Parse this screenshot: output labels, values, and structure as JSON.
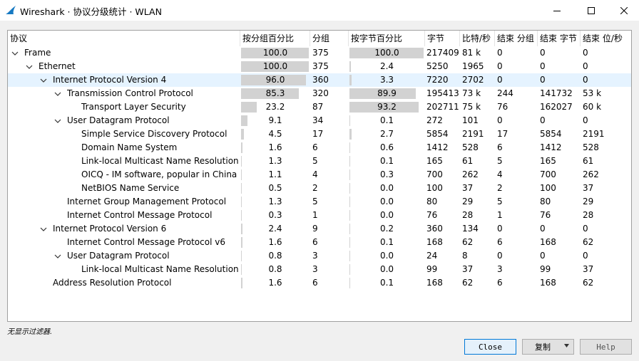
{
  "window": {
    "title": "Wireshark · 协议分级统计 · WLAN"
  },
  "columns": [
    "协议",
    "按分组百分比",
    "分组",
    "按字节百分比",
    "字节",
    "比特/秒",
    "结束 分组",
    "结束 字节",
    "结束 位/秒"
  ],
  "rows": [
    {
      "protocol": "Frame",
      "level": 0,
      "expander": "open",
      "pkt_pct": "100.0",
      "pkts": "375",
      "byte_pct": "100.0",
      "bytes": "217409",
      "bps": "81 k",
      "end_pkts": "0",
      "end_bytes": "0",
      "end_bps": "0"
    },
    {
      "protocol": "Ethernet",
      "level": 1,
      "expander": "open",
      "pkt_pct": "100.0",
      "pkts": "375",
      "byte_pct": "2.4",
      "bytes": "5250",
      "bps": "1965",
      "end_pkts": "0",
      "end_bytes": "0",
      "end_bps": "0"
    },
    {
      "protocol": "Internet Protocol Version 4",
      "level": 2,
      "expander": "open",
      "selected": true,
      "pkt_pct": "96.0",
      "pkts": "360",
      "byte_pct": "3.3",
      "bytes": "7220",
      "bps": "2702",
      "end_pkts": "0",
      "end_bytes": "0",
      "end_bps": "0"
    },
    {
      "protocol": "Transmission Control Protocol",
      "level": 3,
      "expander": "open",
      "pkt_pct": "85.3",
      "pkts": "320",
      "byte_pct": "89.9",
      "bytes": "195413",
      "bps": "73 k",
      "end_pkts": "244",
      "end_bytes": "141732",
      "end_bps": "53 k"
    },
    {
      "protocol": "Transport Layer Security",
      "level": 4,
      "expander": "none",
      "pkt_pct": "23.2",
      "pkts": "87",
      "byte_pct": "93.2",
      "bytes": "202711",
      "bps": "75 k",
      "end_pkts": "76",
      "end_bytes": "162027",
      "end_bps": "60 k"
    },
    {
      "protocol": "User Datagram Protocol",
      "level": 3,
      "expander": "open",
      "pkt_pct": "9.1",
      "pkts": "34",
      "byte_pct": "0.1",
      "bytes": "272",
      "bps": "101",
      "end_pkts": "0",
      "end_bytes": "0",
      "end_bps": "0"
    },
    {
      "protocol": "Simple Service Discovery Protocol",
      "level": 4,
      "expander": "none",
      "pkt_pct": "4.5",
      "pkts": "17",
      "byte_pct": "2.7",
      "bytes": "5854",
      "bps": "2191",
      "end_pkts": "17",
      "end_bytes": "5854",
      "end_bps": "2191"
    },
    {
      "protocol": "Domain Name System",
      "level": 4,
      "expander": "none",
      "pkt_pct": "1.6",
      "pkts": "6",
      "byte_pct": "0.6",
      "bytes": "1412",
      "bps": "528",
      "end_pkts": "6",
      "end_bytes": "1412",
      "end_bps": "528"
    },
    {
      "protocol": "Link-local Multicast Name Resolution",
      "level": 4,
      "expander": "none",
      "pkt_pct": "1.3",
      "pkts": "5",
      "byte_pct": "0.1",
      "bytes": "165",
      "bps": "61",
      "end_pkts": "5",
      "end_bytes": "165",
      "end_bps": "61"
    },
    {
      "protocol": "OICQ - IM software, popular in China",
      "level": 4,
      "expander": "none",
      "pkt_pct": "1.1",
      "pkts": "4",
      "byte_pct": "0.3",
      "bytes": "700",
      "bps": "262",
      "end_pkts": "4",
      "end_bytes": "700",
      "end_bps": "262"
    },
    {
      "protocol": "NetBIOS Name Service",
      "level": 4,
      "expander": "none",
      "pkt_pct": "0.5",
      "pkts": "2",
      "byte_pct": "0.0",
      "bytes": "100",
      "bps": "37",
      "end_pkts": "2",
      "end_bytes": "100",
      "end_bps": "37"
    },
    {
      "protocol": "Internet Group Management Protocol",
      "level": 3,
      "expander": "none",
      "pkt_pct": "1.3",
      "pkts": "5",
      "byte_pct": "0.0",
      "bytes": "80",
      "bps": "29",
      "end_pkts": "5",
      "end_bytes": "80",
      "end_bps": "29"
    },
    {
      "protocol": "Internet Control Message Protocol",
      "level": 3,
      "expander": "none",
      "pkt_pct": "0.3",
      "pkts": "1",
      "byte_pct": "0.0",
      "bytes": "76",
      "bps": "28",
      "end_pkts": "1",
      "end_bytes": "76",
      "end_bps": "28"
    },
    {
      "protocol": "Internet Protocol Version 6",
      "level": 2,
      "expander": "open",
      "pkt_pct": "2.4",
      "pkts": "9",
      "byte_pct": "0.2",
      "bytes": "360",
      "bps": "134",
      "end_pkts": "0",
      "end_bytes": "0",
      "end_bps": "0"
    },
    {
      "protocol": "Internet Control Message Protocol v6",
      "level": 3,
      "expander": "none",
      "pkt_pct": "1.6",
      "pkts": "6",
      "byte_pct": "0.1",
      "bytes": "168",
      "bps": "62",
      "end_pkts": "6",
      "end_bytes": "168",
      "end_bps": "62"
    },
    {
      "protocol": "User Datagram Protocol",
      "level": 3,
      "expander": "open",
      "pkt_pct": "0.8",
      "pkts": "3",
      "byte_pct": "0.0",
      "bytes": "24",
      "bps": "8",
      "end_pkts": "0",
      "end_bytes": "0",
      "end_bps": "0"
    },
    {
      "protocol": "Link-local Multicast Name Resolution",
      "level": 4,
      "expander": "none",
      "pkt_pct": "0.8",
      "pkts": "3",
      "byte_pct": "0.0",
      "bytes": "99",
      "bps": "37",
      "end_pkts": "3",
      "end_bytes": "99",
      "end_bps": "37"
    },
    {
      "protocol": "Address Resolution Protocol",
      "level": 2,
      "expander": "none",
      "pkt_pct": "1.6",
      "pkts": "6",
      "byte_pct": "0.1",
      "bytes": "168",
      "bps": "62",
      "end_pkts": "6",
      "end_bytes": "168",
      "end_bps": "62"
    }
  ],
  "status": {
    "filter_text": "无显示过滤器."
  },
  "buttons": {
    "close": "Close",
    "copy": "复制",
    "help": "Help"
  },
  "colors": {
    "bar": "#d2d2d2",
    "selected_row": "#e5f3ff",
    "focus_border": "#0078d7",
    "app_icon": "#1679c2"
  },
  "icons": {
    "app": "wireshark-fin-icon",
    "expander": "chevron-down-icon",
    "copy_menu": "caret-down-icon"
  }
}
